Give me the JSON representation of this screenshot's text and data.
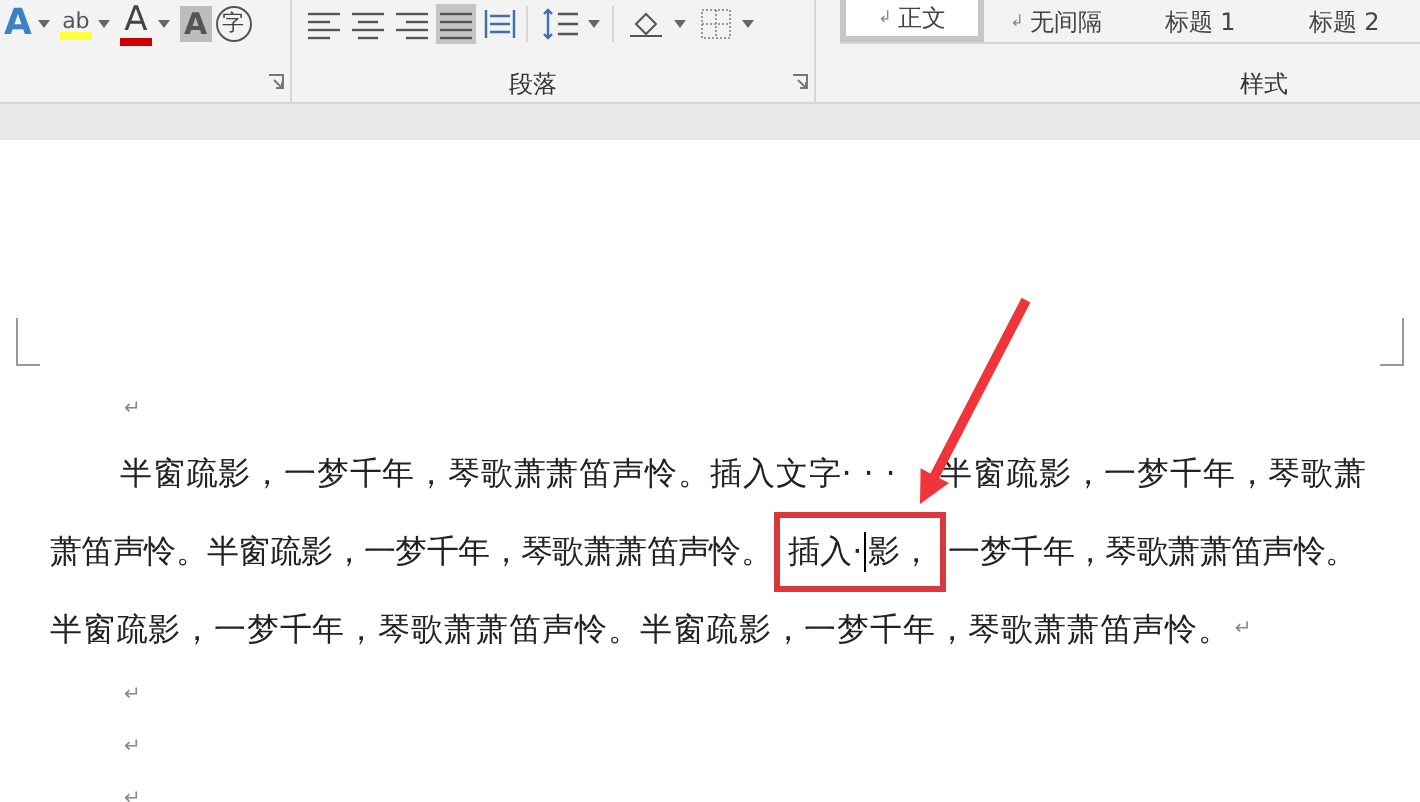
{
  "ribbon": {
    "font_tools": [
      {
        "kind": "glyph",
        "glyph": "A"
      },
      {
        "kind": "highlight",
        "glyph": "ab"
      },
      {
        "kind": "fontcolor",
        "glyph": "A"
      },
      {
        "kind": "shade",
        "glyph": "A"
      },
      {
        "kind": "circle",
        "glyph": "字"
      }
    ],
    "paragraph_tools": [
      {
        "kind": "left",
        "selected": false
      },
      {
        "kind": "center",
        "selected": false
      },
      {
        "kind": "right",
        "selected": false
      },
      {
        "kind": "justify",
        "selected": true
      },
      {
        "kind": "distributed",
        "selected": false
      },
      {
        "kind": "spacing",
        "selected": false
      },
      {
        "kind": "shading",
        "selected": false
      },
      {
        "kind": "borders",
        "selected": false
      }
    ],
    "paragraph_label": "段落",
    "styles": [
      {
        "mark": "↲",
        "label": "正文",
        "selected": true
      },
      {
        "mark": "↲",
        "label": "无间隔",
        "selected": false
      },
      {
        "label": "标题 1",
        "selected": false
      },
      {
        "label": "标题 2",
        "selected": false
      }
    ],
    "styles_label": "样式"
  },
  "document": {
    "blocks": [
      {
        "kind": "empty",
        "mark": "↵"
      },
      {
        "kind": "line",
        "indent": true,
        "text": "半窗疏影，一梦千年，琴歌萧萧笛声怜。插入文字· · ·    半窗疏影，一梦千年，琴歌萧"
      },
      {
        "kind": "boxed",
        "before": "萧笛声怜。半窗疏影，一梦千年，琴歌萧萧笛声怜。",
        "boxed_before_caret": "插入·",
        "boxed_after_caret": "影，",
        "after": "一梦千年，琴歌萧萧笛声怜。"
      },
      {
        "kind": "line",
        "indent": false,
        "text": "半窗疏影，一梦千年，琴歌萧萧笛声怜。半窗疏影，一梦千年，琴歌萧萧笛声怜。",
        "mark": "↵"
      },
      {
        "kind": "empty",
        "mark": "↵"
      },
      {
        "kind": "empty",
        "mark": "↵"
      },
      {
        "kind": "empty",
        "mark": "↵"
      }
    ]
  }
}
